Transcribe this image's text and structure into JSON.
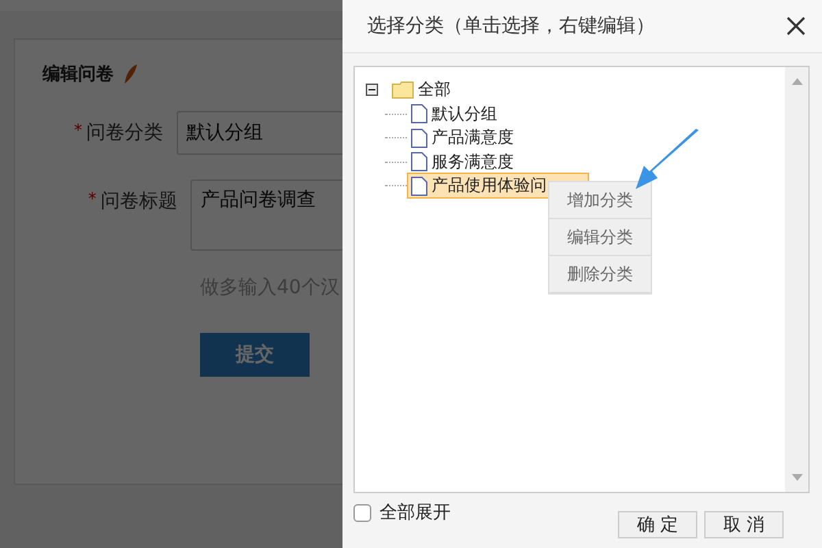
{
  "page": {
    "title": "编辑问卷",
    "fields": [
      {
        "label": "问卷分类",
        "required_mark": "*",
        "kind": "input",
        "value": "默认分组"
      },
      {
        "label": "问卷标题",
        "required_mark": "*",
        "kind": "textarea",
        "value": "产品问卷调查"
      }
    ],
    "hint": "做多输入40个汉",
    "submit": "提交"
  },
  "dialog": {
    "title": "选择分类（单击选择，右键编辑）",
    "tree": [
      {
        "label": "全部",
        "kind": "folder",
        "expanded": true,
        "selected": false,
        "children": [
          {
            "label": "默认分组",
            "kind": "file",
            "selected": false
          },
          {
            "label": "产品满意度",
            "kind": "file",
            "selected": false
          },
          {
            "label": "服务满意度",
            "kind": "file",
            "selected": false
          },
          {
            "label": "产品使用体验问",
            "kind": "file",
            "selected": true
          }
        ]
      }
    ],
    "context_menu": [
      "增加分类",
      "编辑分类",
      "删除分类"
    ],
    "expand_all": {
      "label": "全部展开",
      "checked": false
    },
    "buttons": [
      "确 定",
      "取 消"
    ]
  }
}
